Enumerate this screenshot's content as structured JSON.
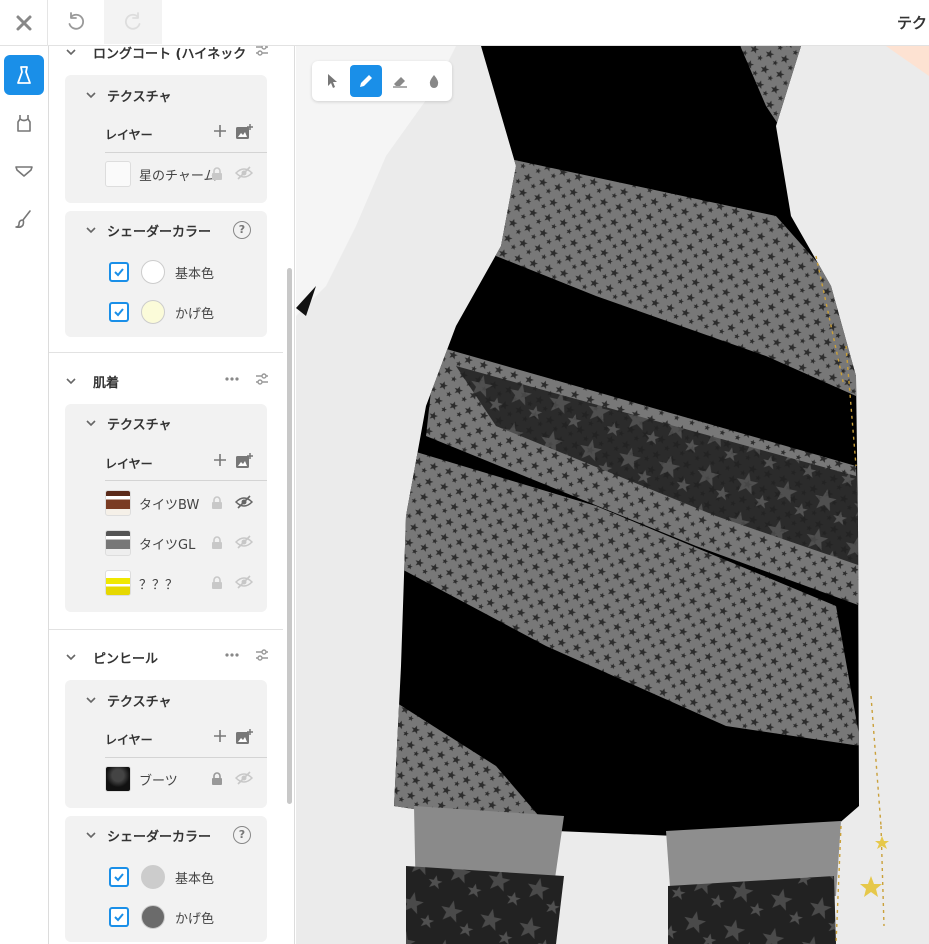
{
  "topbar": {
    "title": "テク"
  },
  "sections": [
    {
      "title": "ロングコート (ハイネック",
      "texture": {
        "title": "テクスチャ",
        "layers_label": "レイヤー",
        "layers": [
          {
            "name": "星のチャーム"
          }
        ]
      },
      "shader": {
        "title": "シェーダーカラー",
        "colors": [
          {
            "label": "基本色",
            "checked": true,
            "color": "#ffffff"
          },
          {
            "label": "かげ色",
            "checked": true,
            "color": "#fbfbd9"
          }
        ]
      }
    },
    {
      "title": "肌着",
      "texture": {
        "title": "テクスチャ",
        "layers_label": "レイヤー",
        "layers": [
          {
            "name": "タイツBW"
          },
          {
            "name": "タイツGL"
          },
          {
            "name": "？？？"
          }
        ]
      }
    },
    {
      "title": "ピンヒール",
      "texture": {
        "title": "テクスチャ",
        "layers_label": "レイヤー",
        "layers": [
          {
            "name": "ブーツ"
          }
        ]
      },
      "shader": {
        "title": "シェーダーカラー",
        "colors": [
          {
            "label": "基本色",
            "checked": true,
            "color": "#cccccc"
          },
          {
            "label": "かげ色",
            "checked": true,
            "color": "#6b6b6b"
          }
        ]
      }
    }
  ],
  "toolbar": {
    "active_tool": "pen"
  },
  "colors": {
    "accent": "#1a8fe8"
  }
}
